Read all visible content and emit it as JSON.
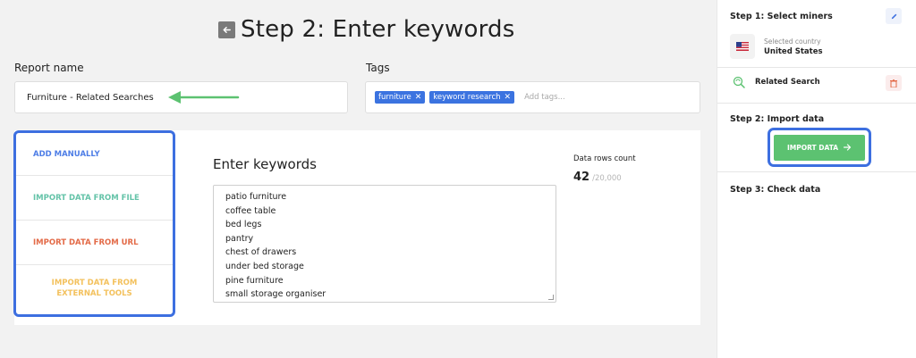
{
  "page": {
    "title": "Step 2: Enter keywords"
  },
  "report": {
    "label": "Report name",
    "value": "Furniture - Related Searches"
  },
  "tags": {
    "label": "Tags",
    "items": [
      "furniture",
      "keyword research"
    ],
    "placeholder": "Add tags..."
  },
  "methods": {
    "add_manually": "ADD MANUALLY",
    "import_file": "IMPORT DATA FROM FILE",
    "import_url": "IMPORT DATA FROM URL",
    "import_external": "IMPORT DATA FROM EXTERNAL TOOLS"
  },
  "keywords": {
    "title": "Enter keywords",
    "lines": [
      "patio furniture",
      "coffee table",
      "bed legs",
      "pantry",
      "chest of drawers",
      "under bed storage",
      "pine furniture",
      "small storage organiser"
    ]
  },
  "rows": {
    "label": "Data rows count",
    "count": "42",
    "max": "/20,000"
  },
  "sidebar": {
    "step1": "Step 1: Select miners",
    "country_label": "Selected country",
    "country_value": "United States",
    "miner": "Related Search",
    "step2": "Step 2: Import data",
    "import_button": "IMPORT DATA",
    "step3": "Step 3: Check data"
  },
  "colors": {
    "accent_blue": "#3d6fe0",
    "import_green": "#5cc271",
    "file_teal": "#64c3a8",
    "url_orange": "#e36a47",
    "external_yellow": "#f3c15d"
  },
  "icons": [
    "back-arrow-icon",
    "close-icon",
    "pencil-icon",
    "us-flag-icon",
    "search-refresh-icon",
    "trash-icon",
    "arrow-right-icon"
  ]
}
